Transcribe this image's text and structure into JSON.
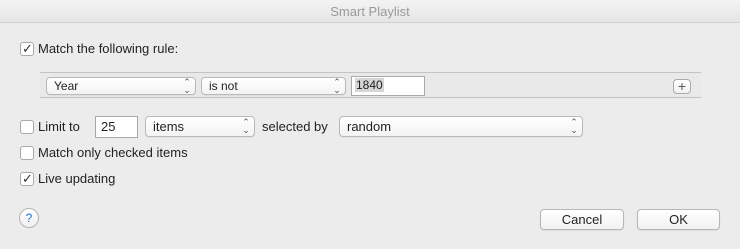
{
  "window": {
    "title": "Smart Playlist"
  },
  "match_rule": {
    "checked": true,
    "label": "Match the following rule:"
  },
  "rule": {
    "field": "Year",
    "operator": "is not",
    "value": "1840",
    "add_label": "+"
  },
  "limit": {
    "checked": false,
    "label": "Limit to",
    "amount": "25",
    "unit": "items",
    "selected_by_label": "selected by",
    "selected_by": "random"
  },
  "match_checked": {
    "checked": false,
    "label": "Match only checked items"
  },
  "live_updating": {
    "checked": true,
    "label": "Live updating"
  },
  "footer": {
    "help_label": "?",
    "cancel_label": "Cancel",
    "ok_label": "OK"
  },
  "icons": {
    "checkmark": "checkmark-icon",
    "popup_arrows": "chevron-updown-icon",
    "help": "question-icon",
    "add": "plus-icon"
  }
}
